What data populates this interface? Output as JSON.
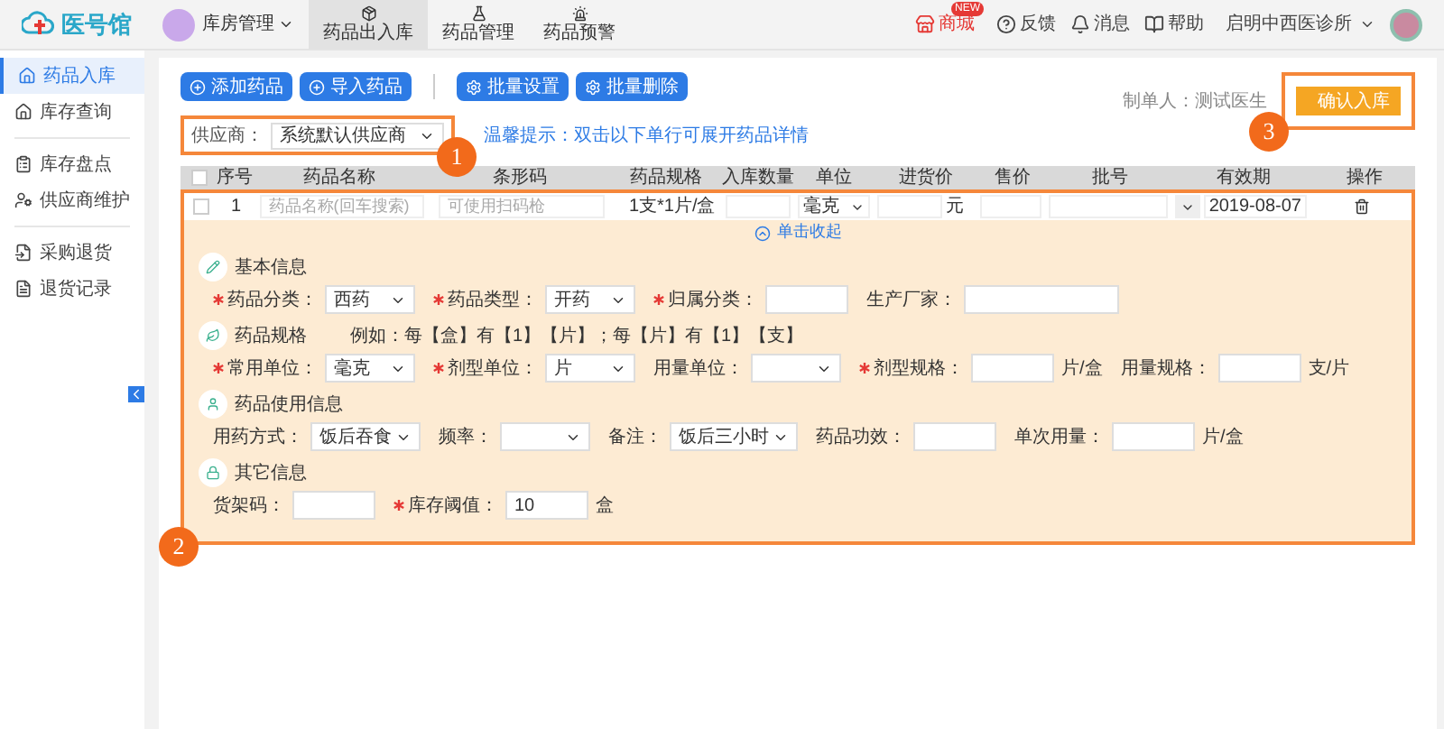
{
  "header": {
    "logo": "医号馆",
    "module": "库房管理",
    "tabs": [
      {
        "label": "药品出入库",
        "kind": "box",
        "selected": true
      },
      {
        "label": "药品管理",
        "kind": "flask",
        "selected": false
      },
      {
        "label": "药品预警",
        "kind": "alert",
        "selected": false
      }
    ],
    "shop": {
      "label": "商城",
      "badge": "NEW"
    },
    "links": [
      {
        "label": "反馈",
        "kind": "help"
      },
      {
        "label": "消息",
        "kind": "bell"
      },
      {
        "label": "帮助",
        "kind": "book"
      }
    ],
    "clinic": "启明中西医诊所"
  },
  "sidebar": {
    "groups": [
      [
        {
          "label": "药品入库",
          "kind": "in",
          "selected": true
        },
        {
          "label": "库存查询",
          "kind": "home",
          "selected": false
        }
      ],
      [
        {
          "label": "库存盘点",
          "kind": "check",
          "selected": false
        },
        {
          "label": "供应商维护",
          "kind": "supplier",
          "selected": false
        }
      ],
      [
        {
          "label": "采购退货",
          "kind": "return",
          "selected": false
        },
        {
          "label": "退货记录",
          "kind": "record",
          "selected": false
        }
      ]
    ]
  },
  "toolbar": [
    {
      "label": "添加药品",
      "kind": "add"
    },
    {
      "label": "导入药品",
      "kind": "add"
    },
    {
      "label": "批量设置",
      "kind": "settings"
    },
    {
      "label": "批量删除",
      "kind": "settings"
    }
  ],
  "maker": "制单人：测试医生",
  "confirm": "确认入库",
  "supplier": {
    "label": "供应商：",
    "value": "系统默认供应商"
  },
  "hint": "温馨提示：双击以下单行可展开药品详情",
  "table": {
    "all_checked": false,
    "columns": [
      "序号",
      "药品名称",
      "条形码",
      "药品规格",
      "入库数量",
      "单位",
      "进货价",
      "售价",
      "批号",
      "有效期",
      "操作"
    ],
    "row": {
      "index": "1",
      "name_placeholder": "药品名称(回车搜索)",
      "barcode_placeholder": "可使用扫码枪",
      "spec": "1支*1片/盒",
      "unit": "毫克",
      "price_suffix": "元",
      "expiry": "2019-08-07",
      "checked": false
    }
  },
  "collapse": "单击收起",
  "sections": [
    {
      "title": "基本信息",
      "kind": "pen",
      "fields": [
        {
          "label": "药品分类：",
          "required": true,
          "kind": "select",
          "value": "西药"
        },
        {
          "label": "药品类型：",
          "required": true,
          "kind": "select",
          "value": "开药"
        },
        {
          "label": "归属分类：",
          "required": true,
          "kind": "input"
        },
        {
          "label": "生产厂家：",
          "required": false,
          "kind": "input",
          "wide": true
        }
      ]
    },
    {
      "title": "药品规格",
      "kind": "leaf",
      "note": "例如：每【盒】有【1】【片】；每【片】有【1】【支】",
      "fields": [
        {
          "label": "常用单位：",
          "required": true,
          "kind": "select",
          "value": "毫克"
        },
        {
          "label": "剂型单位：",
          "required": true,
          "kind": "select",
          "value": "片"
        },
        {
          "label": "用量单位：",
          "required": false,
          "kind": "select"
        },
        {
          "label": "剂型规格：",
          "required": true,
          "kind": "input",
          "suffix": "片/盒"
        },
        {
          "label": "用量规格：",
          "required": false,
          "kind": "input",
          "suffix": "支/片"
        }
      ]
    },
    {
      "title": "药品使用信息",
      "kind": "user",
      "fields": [
        {
          "label": "用药方式：",
          "required": false,
          "kind": "select",
          "value": "饭后吞食"
        },
        {
          "label": "频率：",
          "required": false,
          "kind": "select"
        },
        {
          "label": "备注：",
          "required": false,
          "kind": "select",
          "value": "饭后三小时"
        },
        {
          "label": "药品功效：",
          "required": false,
          "kind": "input"
        },
        {
          "label": "单次用量：",
          "required": false,
          "kind": "input",
          "suffix": "片/盒"
        }
      ]
    },
    {
      "title": "其它信息",
      "kind": "lock",
      "fields": [
        {
          "label": "货架码：",
          "required": false,
          "kind": "input"
        },
        {
          "label": "库存阈值：",
          "required": true,
          "kind": "input",
          "value": "10",
          "suffix": "盒"
        }
      ]
    }
  ],
  "callouts": [
    "1",
    "2",
    "3"
  ]
}
